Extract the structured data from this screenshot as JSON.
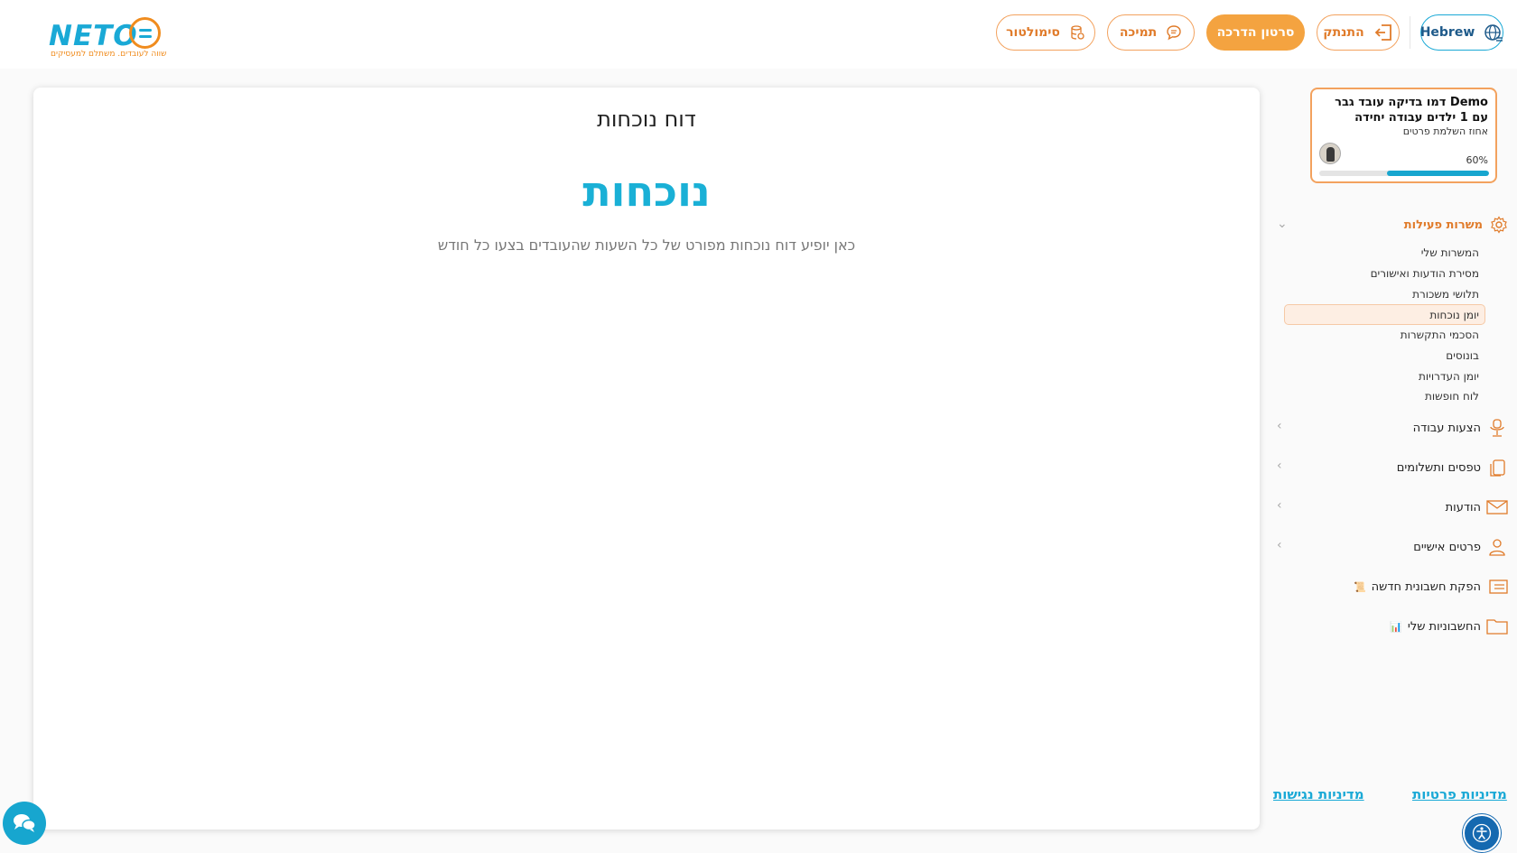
{
  "header": {
    "logo_text": "NETO",
    "logo_tagline": "שווה לעובדים. משתלם למעסיקים",
    "lang_button": "Hebrew",
    "logout_button": "התנתק",
    "tutorial_button": "סרטון הדרכה",
    "support_button": "תמיכה",
    "simulator_button": "סימולטור"
  },
  "main": {
    "title": "דוח נוכחות",
    "heading": "נוכחות",
    "description": "כאן יופיע דוח נוכחות מפורט של כל השעות שהעובדים בצעו כל חודש"
  },
  "profile": {
    "name": "Demo דמו בדיקה עובד גבר עם 1 ילדים עבודה יחידה",
    "completion_label": "אחוז השלמת פרטים",
    "completion_percent_text": "60%",
    "completion_fraction": 0.6
  },
  "sidebar": {
    "section": {
      "label": "משרות פעילות",
      "icon": "gear-icon",
      "items": [
        {
          "label": "המשרות שלי"
        },
        {
          "label": "מסירת הודעות ואישורים"
        },
        {
          "label": "תלושי משכורת"
        },
        {
          "label": "יומן נוכחות",
          "active": true
        },
        {
          "label": "הסכמי התקשרות"
        },
        {
          "label": "בונוסים"
        },
        {
          "label": "יומן העדרויות"
        },
        {
          "label": "לוח חופשות"
        }
      ]
    },
    "items": [
      {
        "label": "הצעות עבודה",
        "icon": "chair-icon"
      },
      {
        "label": "טפסים ותשלומים",
        "icon": "documents-icon"
      },
      {
        "label": "הודעות",
        "icon": "envelope-icon"
      },
      {
        "label": "פרטים אישיים",
        "icon": "person-icon"
      },
      {
        "label": "הפקת חשבונית חדשה",
        "icon": "invoice-icon",
        "badge": "📜"
      },
      {
        "label": "החשבוניות שלי",
        "icon": "folder-icon",
        "badge": "📊"
      }
    ]
  },
  "footer": {
    "privacy_link": "מדיניות פרטיות",
    "accessibility_link": "מדיניות נגישות"
  },
  "colors": {
    "brand_blue": "#1aa9d6",
    "brand_orange": "#f08c1e",
    "active_bg": "#fdeee3"
  }
}
